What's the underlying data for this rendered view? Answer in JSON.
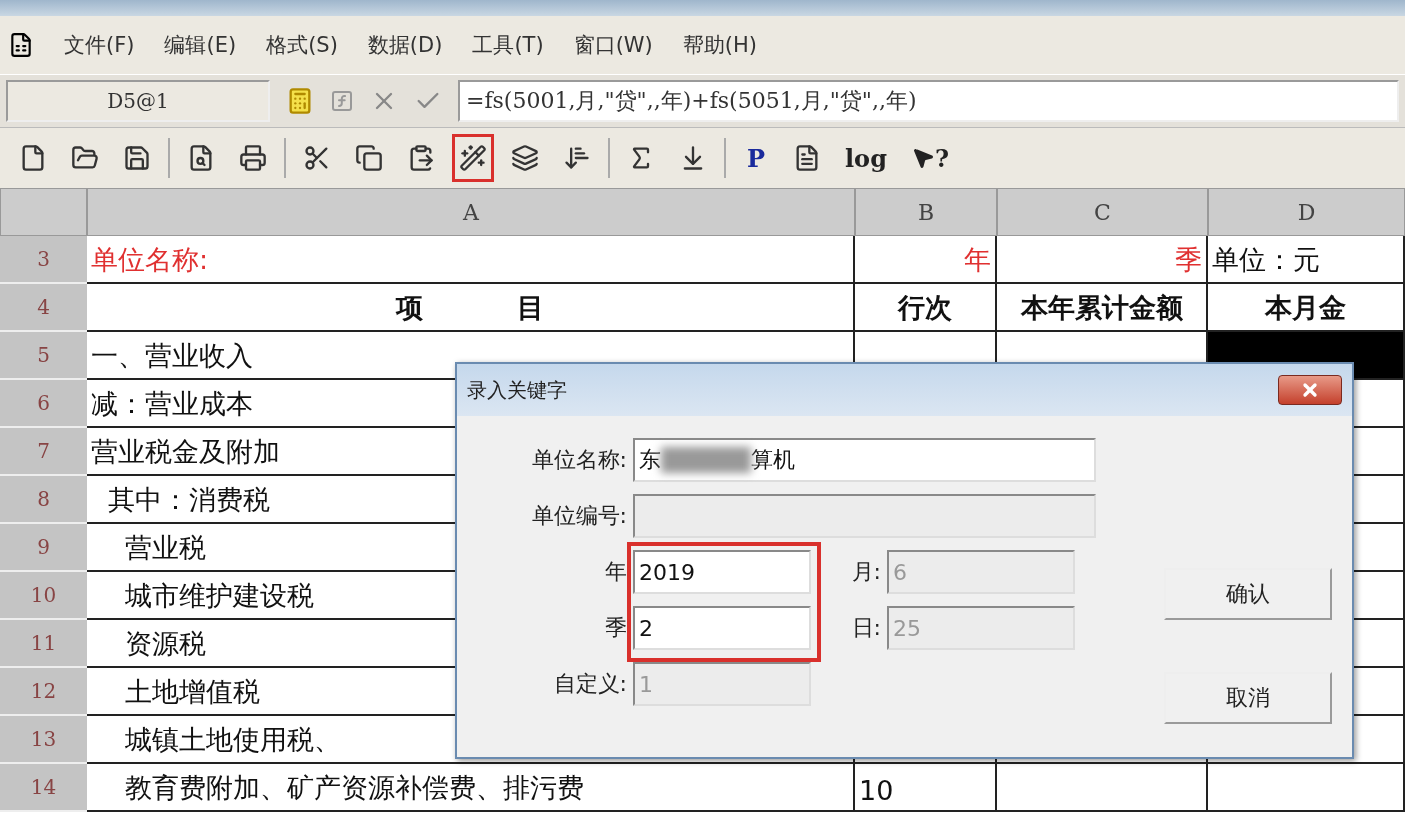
{
  "menu_bar": {
    "items": [
      "文件(F)",
      "编辑(E)",
      "格式(S)",
      "数据(D)",
      "工具(T)",
      "窗口(W)",
      "帮助(H)"
    ]
  },
  "formula_bar": {
    "cell_ref": "D5@1",
    "formula": "=fs(5001,月,\"贷\",,年)+fs(5051,月,\"贷\",,年)"
  },
  "toolbar": [
    {
      "kind": "icon",
      "highlighted": false
    },
    {
      "kind": "icon",
      "highlighted": false
    },
    {
      "kind": "icon",
      "highlighted": false
    },
    {
      "kind": "separator"
    },
    {
      "kind": "icon",
      "highlighted": false
    },
    {
      "kind": "icon",
      "highlighted": false
    },
    {
      "kind": "separator"
    },
    {
      "kind": "icon",
      "highlighted": false
    },
    {
      "kind": "icon",
      "highlighted": false
    },
    {
      "kind": "icon",
      "highlighted": false
    },
    {
      "kind": "icon",
      "highlighted": true
    },
    {
      "kind": "icon",
      "highlighted": false
    },
    {
      "kind": "icon",
      "highlighted": false
    },
    {
      "kind": "separator"
    },
    {
      "kind": "icon",
      "highlighted": false
    },
    {
      "kind": "icon",
      "highlighted": false
    },
    {
      "kind": "separator"
    },
    {
      "kind": "text",
      "label": "P",
      "highlighted": false
    },
    {
      "kind": "icon",
      "highlighted": false
    },
    {
      "kind": "text",
      "label": "log",
      "highlighted": false
    },
    {
      "kind": "help",
      "label": "?",
      "highlighted": false
    }
  ],
  "sheet": {
    "columns": [
      "A",
      "B",
      "C",
      "D"
    ],
    "rows": [
      {
        "num": "3",
        "cells": [
          {
            "text": "单位名称:",
            "kind": "title",
            "selected": false
          },
          {
            "text": "年",
            "kind": "key",
            "selected": false
          },
          {
            "text": "季",
            "kind": "key",
            "selected": false
          },
          {
            "text": "单位：元",
            "kind": "plain",
            "selected": false
          }
        ]
      },
      {
        "num": "4",
        "cells": [
          {
            "text": "项          目",
            "kind": "header",
            "selected": false
          },
          {
            "text": "行次",
            "kind": "header",
            "selected": false
          },
          {
            "text": "本年累计金额",
            "kind": "header",
            "selected": false
          },
          {
            "text": "本月金",
            "kind": "header",
            "selected": false
          }
        ]
      },
      {
        "num": "5",
        "cells": [
          {
            "text": "一、营业收入",
            "kind": "plain",
            "selected": false
          },
          {
            "kind": "plain",
            "selected": false
          },
          {
            "kind": "plain",
            "selected": false
          },
          {
            "kind": "plain",
            "selected": true
          }
        ]
      },
      {
        "num": "6",
        "cells": [
          {
            "text": "减：营业成本",
            "kind": "plain",
            "selected": false
          }
        ]
      },
      {
        "num": "7",
        "cells": [
          {
            "text": "营业税金及附加",
            "kind": "plain",
            "selected": false
          }
        ]
      },
      {
        "num": "8",
        "cells": [
          {
            "text": "  其中：消费税",
            "kind": "plain",
            "selected": false
          }
        ]
      },
      {
        "num": "9",
        "cells": [
          {
            "text": "    营业税",
            "kind": "plain",
            "selected": false
          }
        ]
      },
      {
        "num": "10",
        "cells": [
          {
            "text": "    城市维护建设税",
            "kind": "plain",
            "selected": false
          }
        ]
      },
      {
        "num": "11",
        "cells": [
          {
            "text": "    资源税",
            "kind": "plain",
            "selected": false
          }
        ]
      },
      {
        "num": "12",
        "cells": [
          {
            "text": "    土地增值税",
            "kind": "plain",
            "selected": false
          }
        ]
      },
      {
        "num": "13",
        "cells": [
          {
            "text": "    城镇土地使用税、",
            "kind": "plain",
            "selected": false
          }
        ]
      },
      {
        "num": "14",
        "cells": [
          {
            "text": "    教育费附加、矿产资源补偿费、排污费",
            "kind": "plain",
            "selected": false
          },
          {
            "text": "10",
            "kind": "plain",
            "selected": false
          }
        ]
      }
    ]
  },
  "dialog": {
    "title": "录入关键字",
    "name_field": {
      "label": "单位名称:",
      "value_start": "东",
      "value_end": "算机",
      "blurred": true
    },
    "code_field": {
      "label": "单位编号:",
      "disabled": true
    },
    "fields": [
      {
        "label": "年",
        "value": "2019",
        "disabled": false
      },
      {
        "label": "月:",
        "value": "6",
        "disabled": true
      },
      {
        "label": "季",
        "value": "2",
        "disabled": false
      },
      {
        "label": "日:",
        "value": "25",
        "disabled": true
      },
      {
        "label": "自定义:",
        "value": "1",
        "disabled": true
      }
    ],
    "annotations": [
      {
        "kind": "frame"
      }
    ],
    "buttons": [
      "确认",
      "取消"
    ]
  }
}
